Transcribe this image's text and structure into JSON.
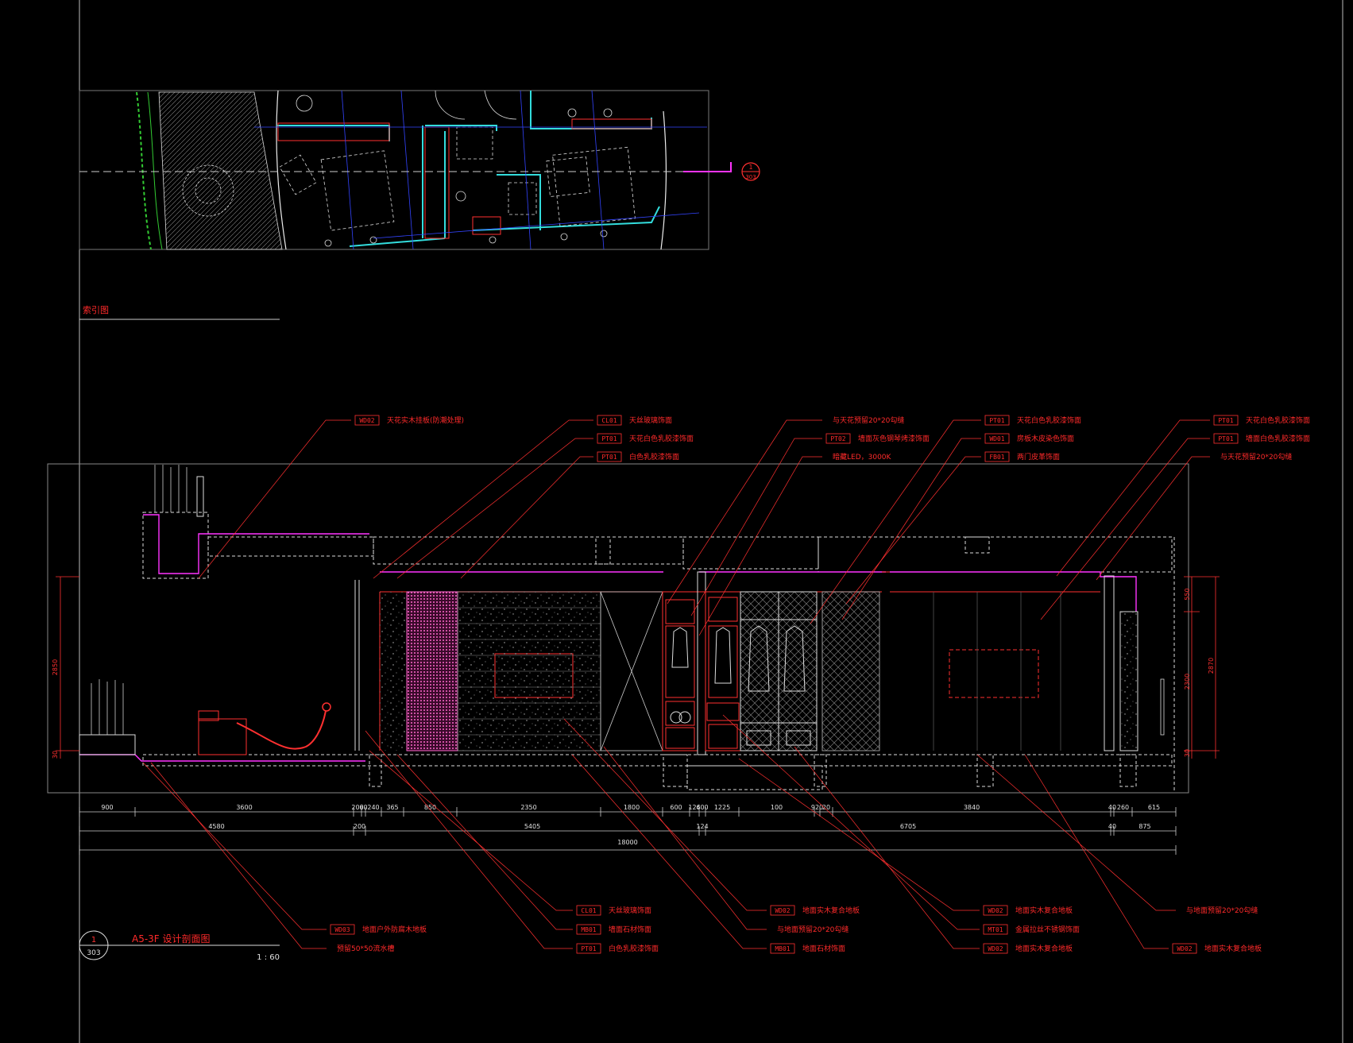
{
  "plan": {
    "section_marker": {
      "number": "1",
      "sheet": "303"
    },
    "caption": "索引图"
  },
  "title_block": {
    "bubble_number": "1",
    "bubble_sheet": "303",
    "title": "A5-3F  设计剖面图",
    "scale": "1 : 60"
  },
  "top_callouts": [
    {
      "code": "WD02",
      "text": "天花实木挂板(防潮处理)"
    },
    {
      "code": "CL01",
      "text": "天丝玻璃饰面"
    },
    {
      "code": "PT01",
      "text": "天花白色乳胶漆饰面"
    },
    {
      "code": "PT01",
      "text": "白色乳胶漆饰面"
    },
    {
      "code": "",
      "text": "与天花预留20*20勾缝"
    },
    {
      "code": "PT02",
      "text": "墙面灰色钢琴烤漆饰面"
    },
    {
      "code": "",
      "text": "暗藏LED，3000K"
    },
    {
      "code": "PT01",
      "text": "天花白色乳胶漆饰面"
    },
    {
      "code": "WD01",
      "text": "房板木皮染色饰面"
    },
    {
      "code": "FB01",
      "text": "两门皮革饰面"
    },
    {
      "code": "PT01",
      "text": "天花白色乳胶漆饰面"
    },
    {
      "code": "PT01",
      "text": "墙面白色乳胶漆饰面"
    },
    {
      "code": "",
      "text": "与天花预留20*20勾缝"
    }
  ],
  "bottom_callouts": [
    {
      "code": "WD03",
      "text": "地面户外防腐木地板"
    },
    {
      "code": "",
      "text": "预留50*50流水槽"
    },
    {
      "code": "CL01",
      "text": "天丝玻璃饰面"
    },
    {
      "code": "MB01",
      "text": "墙面石材饰面"
    },
    {
      "code": "PT01",
      "text": "白色乳胶漆饰面"
    },
    {
      "code": "WD02",
      "text": "地面实木复合地板"
    },
    {
      "code": "",
      "text": "与地面预留20*20勾缝"
    },
    {
      "code": "MB01",
      "text": "地面石材饰面"
    },
    {
      "code": "WD02",
      "text": "地面实木复合地板"
    },
    {
      "code": "MT01",
      "text": "金属拉丝不锈钢饰面"
    },
    {
      "code": "WD02",
      "text": "地面实木复合地板"
    },
    {
      "code": "",
      "text": "与地面预留20*20勾缝"
    },
    {
      "code": "WD02",
      "text": "地面实木复合地板"
    }
  ],
  "dimensions": {
    "row1": [
      "900",
      "3600",
      "200",
      "60",
      "240",
      "365",
      "850",
      "2350",
      "1800",
      "600",
      "124",
      "600",
      "1225",
      "100",
      "920",
      "20",
      "3840",
      "40",
      "260",
      "615"
    ],
    "row2": [
      "4580",
      "200",
      "5405",
      "124",
      "6705",
      "40",
      "875"
    ],
    "total": "18000",
    "left": [
      "2850",
      "30"
    ],
    "right": [
      "550",
      "2300",
      "2870",
      "30"
    ]
  }
}
